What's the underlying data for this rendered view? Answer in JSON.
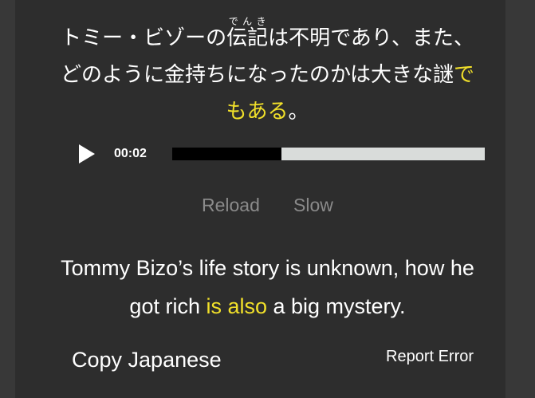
{
  "japanese": {
    "line1_before": "トミー・ビゾーの",
    "ruby_base": "伝記",
    "ruby_reading": "でんき",
    "line1_after": "は不明であり、また、",
    "line2_plain": "どのように金持ちになったのかは大きな謎",
    "line2_highlight": "で",
    "line3_highlight": "もある",
    "line3_plain": "。"
  },
  "player": {
    "time": "00:02",
    "progress_fraction": 0.35,
    "play_icon": "play-icon"
  },
  "controls": {
    "reload": "Reload",
    "slow": "Slow"
  },
  "english": {
    "line1": "Tommy Bizo’s life story is unknown, how he",
    "line2_before": "got rich ",
    "line2_highlight": "is also",
    "line2_after": " a big mystery."
  },
  "actions": {
    "copy_japanese": "Copy Japanese",
    "report_error": "Report Error"
  },
  "colors": {
    "highlight": "#f1e02a",
    "card_background": "#2d2d2d",
    "page_background": "#383838",
    "muted_text": "#8a8a8a"
  }
}
